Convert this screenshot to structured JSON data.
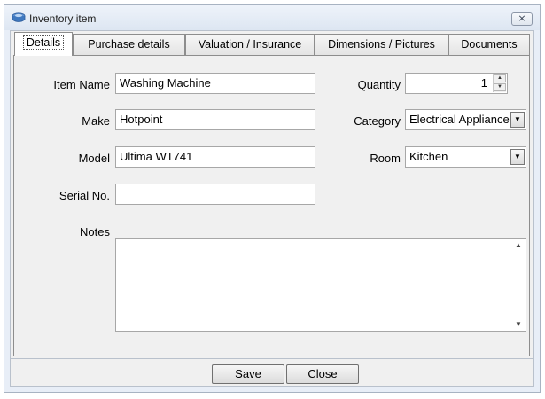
{
  "window": {
    "title": "Inventory item",
    "close_glyph": "⨯",
    "app_icon": "box-icon"
  },
  "tabs": [
    {
      "label": "Details",
      "active": true
    },
    {
      "label": "Purchase details",
      "active": false
    },
    {
      "label": "Valuation / Insurance",
      "active": false
    },
    {
      "label": "Dimensions / Pictures",
      "active": false
    },
    {
      "label": "Documents",
      "active": false
    }
  ],
  "details": {
    "item_name": {
      "label": "Item Name",
      "value": "Washing Machine"
    },
    "make": {
      "label": "Make",
      "value": "Hotpoint"
    },
    "model": {
      "label": "Model",
      "value": "Ultima WT741"
    },
    "serial": {
      "label": "Serial No.",
      "value": ""
    },
    "notes": {
      "label": "Notes",
      "value": ""
    },
    "quantity": {
      "label": "Quantity",
      "value": "1"
    },
    "category": {
      "label": "Category",
      "value": "Electrical Appliance"
    },
    "room": {
      "label": "Room",
      "value": "Kitchen"
    }
  },
  "buttons": {
    "save": {
      "underline": "S",
      "rest": "ave"
    },
    "close": {
      "underline": "C",
      "rest": "lose"
    }
  }
}
